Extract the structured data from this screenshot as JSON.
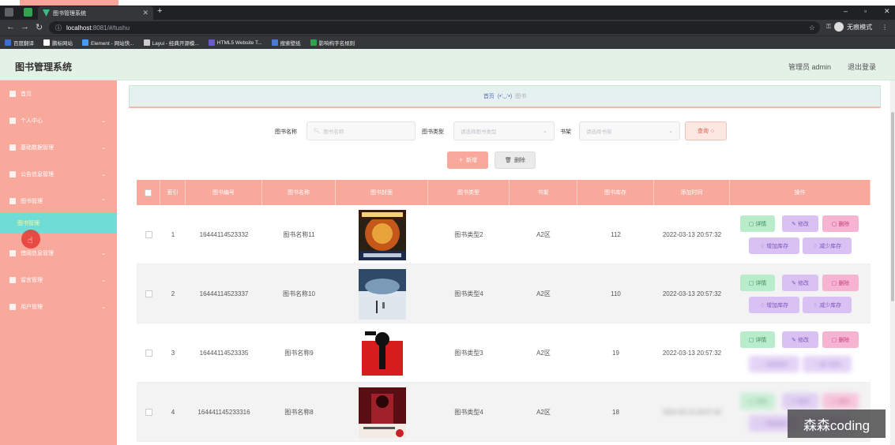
{
  "browser": {
    "tab_title": "图书管理系统",
    "url_host": "localhost",
    "url_path": ":8081/#/tushu",
    "incognito_label": "无痕模式",
    "bookmarks": [
      {
        "label": "百度翻译",
        "color": "#3a6fd8"
      },
      {
        "label": "鹏标网站",
        "color": "#ffffff"
      },
      {
        "label": "Element - 网站快...",
        "color": "#409eff"
      },
      {
        "label": "Layui - 经典开源模...",
        "color": "#cccccc"
      },
      {
        "label": "HTML5 Website T...",
        "color": "#6a5acd"
      },
      {
        "label": "搜索壁纸",
        "color": "#4a7bd8"
      },
      {
        "label": "影响构字名规则",
        "color": "#2ea44f"
      }
    ]
  },
  "header": {
    "title": "图书管理系统",
    "admin": "管理员 admin",
    "logout": "退出登录"
  },
  "sidebar": {
    "items": [
      {
        "label": "首页",
        "has_chevron": false
      },
      {
        "label": "个人中心",
        "has_chevron": true
      },
      {
        "label": "基础数据管理",
        "has_chevron": true
      },
      {
        "label": "公告信息管理",
        "has_chevron": true
      },
      {
        "label": "图书管理",
        "has_chevron": true
      },
      {
        "label": "借阅信息管理",
        "has_chevron": true
      },
      {
        "label": "留言管理",
        "has_chevron": true
      },
      {
        "label": "用户管理",
        "has_chevron": true
      }
    ],
    "active_sub": "图书管理"
  },
  "breadcrumb": {
    "home": "首页",
    "face": "(•'◡'•)",
    "current": "图书"
  },
  "filters": {
    "name_label": "图书名称",
    "name_placeholder": "图书名称",
    "type_label": "图书类型",
    "type_placeholder": "请选择图书类型",
    "shelf_label": "书架",
    "shelf_placeholder": "请选择书架",
    "search_label": "查询"
  },
  "actions": {
    "add_label": "新增",
    "delete_label": "删除"
  },
  "table": {
    "headers": [
      "索引",
      "图书编号",
      "图书名称",
      "图书封面",
      "图书类型",
      "书架",
      "图书库存",
      "添加时间",
      "操作"
    ],
    "rows": [
      {
        "index": "1",
        "code": "16444114523332",
        "name": "图书名称11",
        "type": "图书类型2",
        "shelf": "A2区",
        "stock": "112",
        "time": "2022-03-13 20:57:32"
      },
      {
        "index": "2",
        "code": "16444114523337",
        "name": "图书名称10",
        "type": "图书类型4",
        "shelf": "A2区",
        "stock": "110",
        "time": "2022-03-13 20:57:32"
      },
      {
        "index": "3",
        "code": "16444114523335",
        "name": "图书名称9",
        "type": "图书类型3",
        "shelf": "A2区",
        "stock": "19",
        "time": "2022-03-13 20:57:32"
      },
      {
        "index": "4",
        "code": "164441145233316",
        "name": "图书名称8",
        "type": "图书类型4",
        "shelf": "A2区",
        "stock": "18",
        "time": "2022-03-13 20:57:32"
      }
    ],
    "ops": {
      "detail": "详情",
      "edit": "修改",
      "delete": "删除",
      "add_stock": "增加库存",
      "sub_stock": "减少库存"
    }
  },
  "watermark": "森森coding"
}
